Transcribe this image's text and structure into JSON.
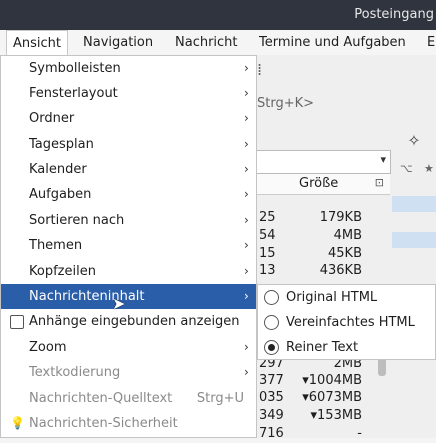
{
  "window": {
    "title": "Posteingang"
  },
  "menubar": {
    "items": [
      {
        "label": "Ansicht",
        "mnemonic_pre": "A",
        "rest": "nsicht"
      },
      {
        "label": "Navigation"
      },
      {
        "label": "Nachricht"
      },
      {
        "label": "Termine und Aufgaben"
      },
      {
        "label": "E"
      }
    ]
  },
  "background": {
    "toolbar_fragment": "⁞",
    "search_hint": "Strg+K>",
    "list_header": "Größe",
    "rows": [
      {
        "a": "25",
        "b": "179KB"
      },
      {
        "a": "54",
        "b": "4MB"
      },
      {
        "a": "15",
        "b": "45KB"
      },
      {
        "a": "13",
        "b": "436KB"
      }
    ],
    "lower_rows": [
      {
        "a": "297",
        "b": "2MB"
      },
      {
        "a": "377",
        "b": "▾1004MB"
      },
      {
        "a": "035",
        "b": "▾6073MB"
      },
      {
        "a": "349",
        "b": "▾153MB"
      },
      {
        "a": "716",
        "b": "-"
      }
    ]
  },
  "view_menu": {
    "items": [
      {
        "label": "Symbolleisten",
        "submenu": true
      },
      {
        "label": "Fensterlayout",
        "submenu": true
      },
      {
        "label": "Ordner",
        "submenu": true
      },
      {
        "label": "Tagesplan",
        "submenu": true
      },
      {
        "label": "Kalender",
        "submenu": true
      },
      {
        "label": "Aufgaben",
        "submenu": true
      },
      {
        "label": "Sortieren nach",
        "submenu": true
      },
      {
        "label": "Themen",
        "submenu": true
      },
      {
        "label": "Kopfzeilen",
        "submenu": true
      },
      {
        "label": "Nachrichteninhalt",
        "submenu": true,
        "highlighted": true
      },
      {
        "label": "Anhänge eingebunden anzeigen",
        "checkbox": true,
        "checked": false
      },
      {
        "label": "Zoom",
        "submenu": true
      },
      {
        "label": "Textkodierung",
        "submenu": true,
        "disabled": true
      },
      {
        "label": "Nachrichten-Quelltext",
        "shortcut": "Strg+U",
        "disabled": true
      },
      {
        "label": "Nachrichten-Sicherheit",
        "disabled": true
      }
    ]
  },
  "body_submenu": {
    "items": [
      {
        "label": "Original HTML",
        "selected": false
      },
      {
        "label": "Vereinfachtes HTML",
        "selected": false
      },
      {
        "label": "Reiner Text",
        "selected": true
      }
    ]
  },
  "colors": {
    "highlight": "#2b5ea8",
    "titlebar": "#2f343f"
  }
}
